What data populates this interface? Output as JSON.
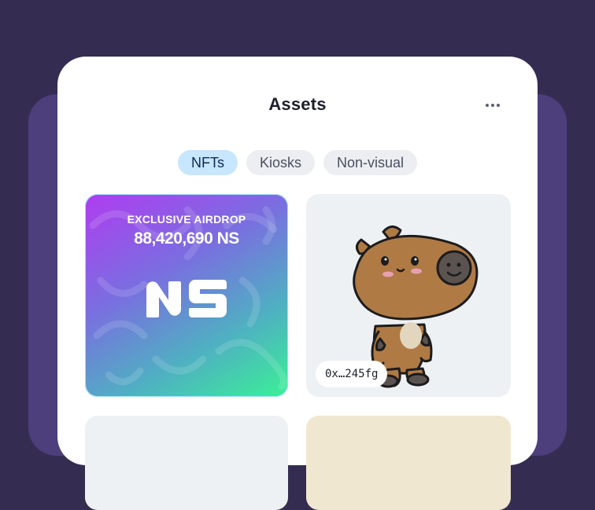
{
  "header": {
    "title": "Assets",
    "more_icon": "ellipsis-icon"
  },
  "tabs": [
    {
      "label": "NFTs",
      "active": true
    },
    {
      "label": "Kiosks",
      "active": false
    },
    {
      "label": "Non-visual",
      "active": false
    }
  ],
  "cards": [
    {
      "kind": "airdrop",
      "label": "EXCLUSIVE AIRDROP",
      "amount": "88,420,690 NS",
      "logo_text": "NS"
    },
    {
      "kind": "nft",
      "image": "capybara-illustration",
      "address": "0x…245fg"
    }
  ],
  "colors": {
    "background": "#352c52",
    "back_card": "#4c3f7c",
    "panel": "#ffffff",
    "active_tab": "#c7e6ff",
    "inactive_tab": "#eceef2"
  }
}
